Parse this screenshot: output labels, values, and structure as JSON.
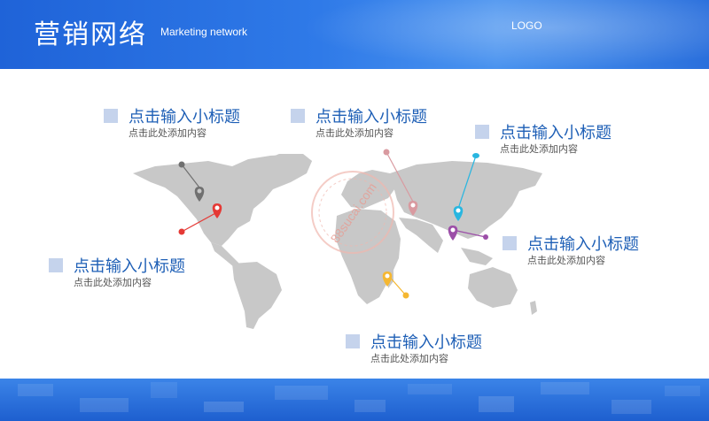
{
  "header": {
    "title": "营销网络",
    "subtitle": "Marketing network",
    "logo": "LOGO"
  },
  "labels": [
    {
      "title": "点击输入小标题",
      "desc": "点击此处添加内容"
    },
    {
      "title": "点击输入小标题",
      "desc": "点击此处添加内容"
    },
    {
      "title": "点击输入小标题",
      "desc": "点击此处添加内容"
    },
    {
      "title": "点击输入小标题",
      "desc": "点击此处添加内容"
    },
    {
      "title": "点击输入小标题",
      "desc": "点击此处添加内容"
    },
    {
      "title": "点击输入小标题",
      "desc": "点击此处添加内容"
    }
  ],
  "watermark": "88sucai.com",
  "colors": {
    "accent": "#1f63d8",
    "heading": "#1e5fb6",
    "marker_gray": "#707070",
    "marker_red": "#e53935",
    "marker_pink": "#d99aa0",
    "marker_cyan": "#29b6e0",
    "marker_purple": "#9c4fa8",
    "marker_yellow": "#f5b731"
  }
}
